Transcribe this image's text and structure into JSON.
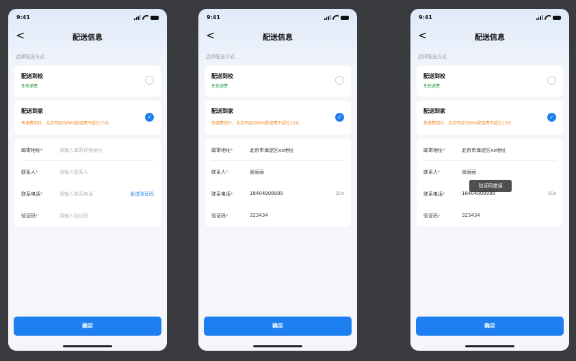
{
  "colors": {
    "background": "#3a3b3f",
    "accent": "#1d7ff0",
    "required": "#f04848",
    "free": "#2a9d4b",
    "note": "#f08a24"
  },
  "screens": [
    {
      "status": {
        "time": "9:41"
      },
      "nav": {
        "back": "<",
        "title": "配送信息"
      },
      "section_label": "选择配送方式",
      "options": [
        {
          "title": "配送到校",
          "subtitle": "免快递费",
          "selected": false
        },
        {
          "title": "配送到家",
          "subtitle": "快递费到付，北京市区内EMS配送费不超过15元",
          "selected": true
        }
      ],
      "form": {
        "address": {
          "label": "邮寄地址",
          "required": "*",
          "placeholder": "请输入邮寄详细地址"
        },
        "contact": {
          "label": "联系人",
          "required": "*",
          "placeholder": "请输入联系人"
        },
        "phone": {
          "label": "联系电话",
          "required": "*",
          "placeholder": "请输入联系电话",
          "action": "发送验证码"
        },
        "code": {
          "label": "验证码",
          "required": "*",
          "placeholder": "请输入验证码"
        }
      },
      "confirm": "确定"
    },
    {
      "status": {
        "time": "9:41"
      },
      "nav": {
        "back": "<",
        "title": "配送信息"
      },
      "section_label": "选择配送方式",
      "options": [
        {
          "title": "配送到校",
          "subtitle": "免快递费",
          "selected": false
        },
        {
          "title": "配送到家",
          "subtitle": "快递费到付，北京市区内EMS配送费不超过15元",
          "selected": true
        }
      ],
      "form": {
        "address": {
          "label": "邮寄地址",
          "required": "*",
          "value": "北京市海淀区xx地址"
        },
        "contact": {
          "label": "联系人",
          "required": "*",
          "value": "张丽丽"
        },
        "phone": {
          "label": "联系电话",
          "required": "*",
          "value": "18404908989",
          "countdown": "30s"
        },
        "code": {
          "label": "验证码",
          "required": "*",
          "value": "323434"
        }
      },
      "confirm": "确定"
    },
    {
      "status": {
        "time": "9:41"
      },
      "nav": {
        "back": "<",
        "title": "配送信息"
      },
      "section_label": "选择配送方式",
      "options": [
        {
          "title": "配送到校",
          "subtitle": "免快递费",
          "selected": false
        },
        {
          "title": "配送到家",
          "subtitle": "快递费到付，北京市区内EMS配送费不超过15元",
          "selected": true
        }
      ],
      "form": {
        "address": {
          "label": "邮寄地址",
          "required": "*",
          "value": "北京市海淀区xx地址"
        },
        "contact": {
          "label": "联系人",
          "required": "*",
          "value": "张丽丽"
        },
        "phone": {
          "label": "联系电话",
          "required": "*",
          "value": "18404908989",
          "countdown": "30s"
        },
        "code": {
          "label": "验证码",
          "required": "*",
          "value": "323434"
        }
      },
      "toast": "验证码错误",
      "confirm": "确定"
    }
  ]
}
